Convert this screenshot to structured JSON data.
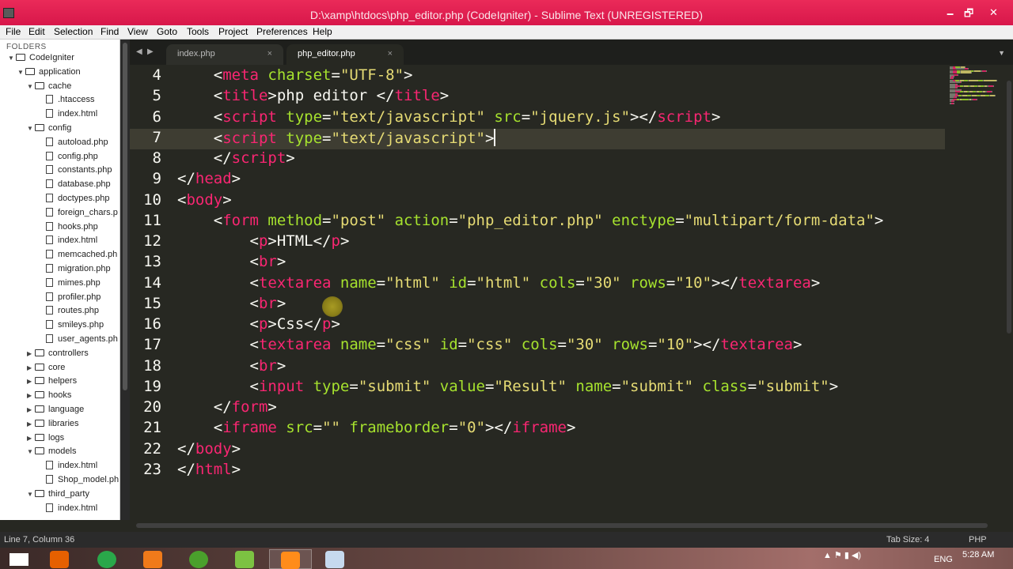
{
  "window": {
    "title": "D:\\xamp\\htdocs\\php_editor.php (CodeIgniter) - Sublime Text (UNREGISTERED)",
    "minimize": "🗕",
    "maximize": "🗗",
    "close": "✕"
  },
  "menu": [
    "File",
    "Edit",
    "Selection",
    "Find",
    "View",
    "Goto",
    "Tools",
    "Project",
    "Preferences",
    "Help"
  ],
  "sidebar": {
    "label": "FOLDERS",
    "items": [
      {
        "label": "CodeIgniter",
        "type": "folder",
        "level": 0,
        "expanded": true
      },
      {
        "label": "application",
        "type": "folder",
        "level": 1,
        "expanded": true
      },
      {
        "label": "cache",
        "type": "folder",
        "level": 2,
        "expanded": true
      },
      {
        "label": ".htaccess",
        "type": "file",
        "level": 3
      },
      {
        "label": "index.html",
        "type": "file",
        "level": 3
      },
      {
        "label": "config",
        "type": "folder",
        "level": 2,
        "expanded": true
      },
      {
        "label": "autoload.php",
        "type": "file",
        "level": 3
      },
      {
        "label": "config.php",
        "type": "file",
        "level": 3
      },
      {
        "label": "constants.php",
        "type": "file",
        "level": 3
      },
      {
        "label": "database.php",
        "type": "file",
        "level": 3
      },
      {
        "label": "doctypes.php",
        "type": "file",
        "level": 3
      },
      {
        "label": "foreign_chars.p",
        "type": "file",
        "level": 3
      },
      {
        "label": "hooks.php",
        "type": "file",
        "level": 3
      },
      {
        "label": "index.html",
        "type": "file",
        "level": 3
      },
      {
        "label": "memcached.ph",
        "type": "file",
        "level": 3
      },
      {
        "label": "migration.php",
        "type": "file",
        "level": 3
      },
      {
        "label": "mimes.php",
        "type": "file",
        "level": 3
      },
      {
        "label": "profiler.php",
        "type": "file",
        "level": 3
      },
      {
        "label": "routes.php",
        "type": "file",
        "level": 3
      },
      {
        "label": "smileys.php",
        "type": "file",
        "level": 3
      },
      {
        "label": "user_agents.ph",
        "type": "file",
        "level": 3
      },
      {
        "label": "controllers",
        "type": "folder",
        "level": 2,
        "expanded": false
      },
      {
        "label": "core",
        "type": "folder",
        "level": 2,
        "expanded": false
      },
      {
        "label": "helpers",
        "type": "folder",
        "level": 2,
        "expanded": false
      },
      {
        "label": "hooks",
        "type": "folder",
        "level": 2,
        "expanded": false
      },
      {
        "label": "language",
        "type": "folder",
        "level": 2,
        "expanded": false
      },
      {
        "label": "libraries",
        "type": "folder",
        "level": 2,
        "expanded": false
      },
      {
        "label": "logs",
        "type": "folder",
        "level": 2,
        "expanded": false
      },
      {
        "label": "models",
        "type": "folder",
        "level": 2,
        "expanded": true
      },
      {
        "label": "index.html",
        "type": "file",
        "level": 3
      },
      {
        "label": "Shop_model.ph",
        "type": "file",
        "level": 3
      },
      {
        "label": "third_party",
        "type": "folder",
        "level": 2,
        "expanded": true
      },
      {
        "label": "index.html",
        "type": "file",
        "level": 3
      }
    ]
  },
  "tabs": [
    {
      "label": "index.php",
      "close": "×",
      "active": false
    },
    {
      "label": "php_editor.php",
      "close": "×",
      "active": true
    }
  ],
  "tab_nav": {
    "prev": "◀",
    "next": "▶",
    "menu": "▼"
  },
  "editor": {
    "current_line": 7,
    "lines": [
      {
        "n": "4",
        "tokens": [
          [
            "p",
            "    <"
          ],
          [
            "t",
            "meta"
          ],
          [
            "a",
            " charset"
          ],
          [
            "p",
            "="
          ],
          [
            "s",
            "\"UTF-8\""
          ],
          [
            "p",
            ">"
          ]
        ]
      },
      {
        "n": "5",
        "tokens": [
          [
            "p",
            "    <"
          ],
          [
            "t",
            "title"
          ],
          [
            "p",
            ">php editor </"
          ],
          [
            "t",
            "title"
          ],
          [
            "p",
            ">"
          ]
        ]
      },
      {
        "n": "6",
        "tokens": [
          [
            "p",
            "    <"
          ],
          [
            "t",
            "script"
          ],
          [
            "a",
            " type"
          ],
          [
            "p",
            "="
          ],
          [
            "s",
            "\"text/javascript\""
          ],
          [
            "a",
            " src"
          ],
          [
            "p",
            "="
          ],
          [
            "s",
            "\"jquery.js\""
          ],
          [
            "p",
            "></"
          ],
          [
            "t",
            "script"
          ],
          [
            "p",
            ">"
          ]
        ]
      },
      {
        "n": "7",
        "tokens": [
          [
            "p",
            "    <"
          ],
          [
            "t",
            "script"
          ],
          [
            "a",
            " type"
          ],
          [
            "p",
            "="
          ],
          [
            "s",
            "\"text/javascript\""
          ],
          [
            "p",
            ">"
          ]
        ]
      },
      {
        "n": "8",
        "tokens": [
          [
            "p",
            "    </"
          ],
          [
            "t",
            "script"
          ],
          [
            "p",
            ">"
          ]
        ]
      },
      {
        "n": "9",
        "tokens": [
          [
            "p",
            "</"
          ],
          [
            "t",
            "head"
          ],
          [
            "p",
            ">"
          ]
        ]
      },
      {
        "n": "10",
        "tokens": [
          [
            "p",
            "<"
          ],
          [
            "t",
            "body"
          ],
          [
            "p",
            ">"
          ]
        ]
      },
      {
        "n": "11",
        "tokens": [
          [
            "p",
            "    <"
          ],
          [
            "t",
            "form"
          ],
          [
            "a",
            " method"
          ],
          [
            "p",
            "="
          ],
          [
            "s",
            "\"post\""
          ],
          [
            "a",
            " action"
          ],
          [
            "p",
            "="
          ],
          [
            "s",
            "\"php_editor.php\""
          ],
          [
            "a",
            " enctype"
          ],
          [
            "p",
            "="
          ],
          [
            "s",
            "\"multipart/form-data\""
          ],
          [
            "p",
            ">"
          ]
        ]
      },
      {
        "n": "12",
        "tokens": [
          [
            "p",
            "        <"
          ],
          [
            "t",
            "p"
          ],
          [
            "p",
            ">HTML</"
          ],
          [
            "t",
            "p"
          ],
          [
            "p",
            ">"
          ]
        ]
      },
      {
        "n": "13",
        "tokens": [
          [
            "p",
            "        <"
          ],
          [
            "t",
            "br"
          ],
          [
            "p",
            ">"
          ]
        ]
      },
      {
        "n": "14",
        "tokens": [
          [
            "p",
            "        <"
          ],
          [
            "t",
            "textarea"
          ],
          [
            "a",
            " name"
          ],
          [
            "p",
            "="
          ],
          [
            "s",
            "\"html\""
          ],
          [
            "a",
            " id"
          ],
          [
            "p",
            "="
          ],
          [
            "s",
            "\"html\""
          ],
          [
            "a",
            " cols"
          ],
          [
            "p",
            "="
          ],
          [
            "s",
            "\"30\""
          ],
          [
            "a",
            " rows"
          ],
          [
            "p",
            "="
          ],
          [
            "s",
            "\"10\""
          ],
          [
            "p",
            "></"
          ],
          [
            "t",
            "textarea"
          ],
          [
            "p",
            ">"
          ]
        ]
      },
      {
        "n": "15",
        "tokens": [
          [
            "p",
            "        <"
          ],
          [
            "t",
            "br"
          ],
          [
            "p",
            ">"
          ]
        ]
      },
      {
        "n": "16",
        "tokens": [
          [
            "p",
            "        <"
          ],
          [
            "t",
            "p"
          ],
          [
            "p",
            ">Css</"
          ],
          [
            "t",
            "p"
          ],
          [
            "p",
            ">"
          ]
        ]
      },
      {
        "n": "17",
        "tokens": [
          [
            "p",
            "        <"
          ],
          [
            "t",
            "textarea"
          ],
          [
            "a",
            " name"
          ],
          [
            "p",
            "="
          ],
          [
            "s",
            "\"css\""
          ],
          [
            "a",
            " id"
          ],
          [
            "p",
            "="
          ],
          [
            "s",
            "\"css\""
          ],
          [
            "a",
            " cols"
          ],
          [
            "p",
            "="
          ],
          [
            "s",
            "\"30\""
          ],
          [
            "a",
            " rows"
          ],
          [
            "p",
            "="
          ],
          [
            "s",
            "\"10\""
          ],
          [
            "p",
            "></"
          ],
          [
            "t",
            "textarea"
          ],
          [
            "p",
            ">"
          ]
        ]
      },
      {
        "n": "18",
        "tokens": [
          [
            "p",
            "        <"
          ],
          [
            "t",
            "br"
          ],
          [
            "p",
            ">"
          ]
        ]
      },
      {
        "n": "19",
        "tokens": [
          [
            "p",
            "        <"
          ],
          [
            "t",
            "input"
          ],
          [
            "a",
            " type"
          ],
          [
            "p",
            "="
          ],
          [
            "s",
            "\"submit\""
          ],
          [
            "a",
            " value"
          ],
          [
            "p",
            "="
          ],
          [
            "s",
            "\"Result\""
          ],
          [
            "a",
            " name"
          ],
          [
            "p",
            "="
          ],
          [
            "s",
            "\"submit\""
          ],
          [
            "a",
            " class"
          ],
          [
            "p",
            "="
          ],
          [
            "s",
            "\"submit\""
          ],
          [
            "p",
            ">"
          ]
        ]
      },
      {
        "n": "20",
        "tokens": [
          [
            "p",
            "    </"
          ],
          [
            "t",
            "form"
          ],
          [
            "p",
            ">"
          ]
        ]
      },
      {
        "n": "21",
        "tokens": [
          [
            "p",
            "    <"
          ],
          [
            "t",
            "iframe"
          ],
          [
            "a",
            " src"
          ],
          [
            "p",
            "="
          ],
          [
            "s",
            "\"\""
          ],
          [
            "a",
            " frameborder"
          ],
          [
            "p",
            "="
          ],
          [
            "s",
            "\"0\""
          ],
          [
            "p",
            "></"
          ],
          [
            "t",
            "iframe"
          ],
          [
            "p",
            ">"
          ]
        ]
      },
      {
        "n": "22",
        "tokens": [
          [
            "p",
            "</"
          ],
          [
            "t",
            "body"
          ],
          [
            "p",
            ">"
          ]
        ]
      },
      {
        "n": "23",
        "tokens": [
          [
            "p",
            "</"
          ],
          [
            "t",
            "html"
          ],
          [
            "p",
            ">"
          ]
        ]
      }
    ]
  },
  "status": {
    "position": "Line 7, Column 36",
    "tab_size": "Tab Size: 4",
    "syntax": "PHP"
  },
  "taskbar": {
    "apps": [
      {
        "name": "start",
        "color": "#ffffff"
      },
      {
        "name": "firefox",
        "color": "#e66000"
      },
      {
        "name": "chrome",
        "color": "#2aa84a"
      },
      {
        "name": "xampp",
        "color": "#f07a1a"
      },
      {
        "name": "utorrent",
        "color": "#4aa02c"
      },
      {
        "name": "notepad-plus",
        "color": "#7cc242"
      },
      {
        "name": "sublime-text",
        "color": "#ff8c1a"
      },
      {
        "name": "explorer",
        "color": "#c6d9ee"
      }
    ],
    "language": "ENG",
    "clock": "5:28 AM"
  },
  "colors": {
    "titlebar": "#e81c4f",
    "editor_bg": "#272822",
    "tag": "#f92672",
    "attr": "#a6e22e",
    "string": "#e6db74",
    "text": "#f8f8f2"
  }
}
